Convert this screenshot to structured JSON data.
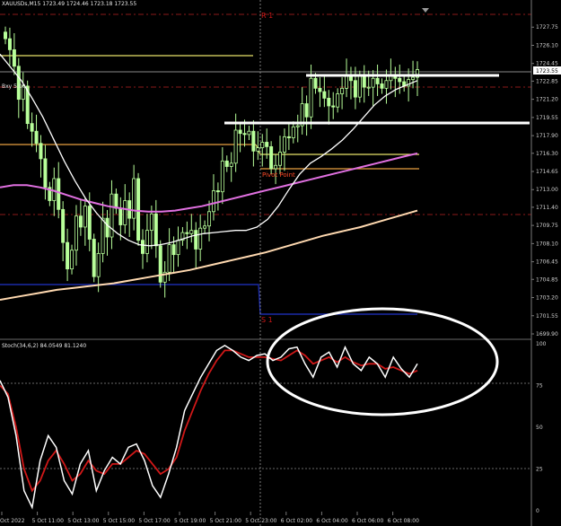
{
  "window": {
    "symbol_line": "XAUUSDs,M15",
    "ohlc_line": "1723.49 1724.46 1723.18 1723.55",
    "small_label": "Bxy 5.00"
  },
  "colors": {
    "background": "#000000",
    "candle": "#b8ff9a",
    "ma_fast": "#ffffff",
    "ma_mid": "#e070e0",
    "ma_slow": "#ffd9b0",
    "level_yellow": "#e8e26a",
    "level_orange": "#e8a040",
    "level_blue": "#1a2aa8",
    "level_red": "#8b1a1a",
    "stoch_main": "#ffffff",
    "stoch_signal": "#d01818",
    "annotation": "#ffffff"
  },
  "chart_data": [
    {
      "type": "candlestick",
      "instrument": "XAUUSDs",
      "timeframe": "M15",
      "price_axis_ticks": [
        "1727.75",
        "1726.10",
        "1724.45",
        "1722.85",
        "1721.20",
        "1719.55",
        "1717.90",
        "1716.30",
        "1714.65",
        "1713.00",
        "1711.40",
        "1709.75",
        "1708.10",
        "1706.45",
        "1704.85",
        "1703.20",
        "1701.55",
        "1699.90"
      ],
      "current_price": "1723.55",
      "ylim": [
        1699.9,
        1729.4
      ],
      "time_ticks": [
        "Oct 2022",
        "5 Oct 11:00",
        "5 Oct 13:00",
        "5 Oct 15:00",
        "5 Oct 17:00",
        "5 Oct 19:00",
        "5 Oct 21:00",
        "5 Oct 23:00",
        "6 Oct 02:00",
        "6 Oct 04:00",
        "6 Oct 06:00",
        "6 Oct 08:00"
      ],
      "close": [
        1726.7,
        1725.7,
        1724.2,
        1721.2,
        1722.4,
        1719.0,
        1718.3,
        1717.2,
        1715.8,
        1713.2,
        1712.0,
        1714.0,
        1711.2,
        1708.2,
        1705.8,
        1707.5,
        1710.6,
        1709.6,
        1711.5,
        1708.5,
        1705.1,
        1707.2,
        1710.4,
        1708.7,
        1712.6,
        1711.3,
        1709.8,
        1712.0,
        1710.4,
        1714.0,
        1708.4,
        1707.2,
        1709.3,
        1710.8,
        1707.9,
        1704.6,
        1705.5,
        1708.0,
        1707.1,
        1708.4,
        1709.1,
        1709.0,
        1709.3,
        1707.6,
        1709.5,
        1709.7,
        1711.0,
        1712.9,
        1712.8,
        1715.6,
        1715.1,
        1715.4,
        1718.4,
        1718.1,
        1718.0,
        1718.3,
        1716.5,
        1716.8,
        1717.3,
        1716.9,
        1714.9,
        1715.2,
        1716.4,
        1717.8,
        1717.7,
        1718.7,
        1718.8,
        1720.8,
        1719.6,
        1723.1,
        1722.2,
        1721.9,
        1721.3,
        1720.6,
        1720.5,
        1721.7,
        1722.2,
        1723.4,
        1722.9,
        1721.4,
        1723.3,
        1722.3,
        1722.3,
        1723.1,
        1722.6,
        1722.2,
        1722.9,
        1723.4,
        1723.1,
        1722.8,
        1722.4,
        1723.0,
        1723.2,
        1723.9
      ],
      "ma_fast": [
        1725.3,
        1724.1,
        1722.9,
        1721.3,
        1719.6,
        1717.6,
        1715.6,
        1713.8,
        1712.2,
        1710.9,
        1709.8,
        1709.0,
        1708.4,
        1708.0,
        1707.9,
        1708.0,
        1708.2,
        1708.5,
        1708.8,
        1709.0,
        1709.1,
        1709.2,
        1709.3,
        1709.3,
        1709.6,
        1710.3,
        1711.5,
        1713.0,
        1714.4,
        1715.4,
        1716.0,
        1716.7,
        1717.5,
        1718.5,
        1719.6,
        1720.7,
        1721.5,
        1722.1,
        1722.5,
        1722.9
      ],
      "ma_mid": [
        1713.2,
        1713.4,
        1713.4,
        1713.2,
        1712.9,
        1712.5,
        1712.1,
        1711.8,
        1711.5,
        1711.3,
        1711.1,
        1711.0,
        1711.0,
        1711.1,
        1711.3,
        1711.5,
        1711.8,
        1712.1,
        1712.4,
        1712.7,
        1713.0,
        1713.3,
        1713.6,
        1713.9,
        1714.2,
        1714.5,
        1714.8,
        1715.1,
        1715.4,
        1715.7,
        1716.0,
        1716.3
      ],
      "ma_slow": [
        1703.0,
        1703.3,
        1703.6,
        1703.9,
        1704.1,
        1704.3,
        1704.5,
        1704.8,
        1705.1,
        1705.4,
        1705.7,
        1706.1,
        1706.5,
        1706.9,
        1707.3,
        1707.8,
        1708.3,
        1708.8,
        1709.2,
        1709.6,
        1710.1,
        1710.6,
        1711.1
      ],
      "levels": [
        {
          "name": "S1",
          "price": 1701.6
        },
        {
          "name": "Pivot Point",
          "price": 1715.2
        }
      ]
    },
    {
      "type": "line",
      "indicator": "Stoch(34,6,2)",
      "header": "Stoch(34,6,2) 84.0549 81.1240",
      "y_ticks": [
        "100",
        "75",
        "50",
        "25",
        "0"
      ],
      "ylim": [
        0,
        100
      ],
      "main": [
        78,
        68,
        45,
        12,
        2,
        30,
        45,
        38,
        18,
        10,
        28,
        36,
        12,
        24,
        32,
        28,
        38,
        40,
        30,
        15,
        8,
        22,
        38,
        60,
        70,
        80,
        88,
        96,
        99,
        96,
        92,
        90,
        93,
        94,
        90,
        92,
        97,
        98,
        88,
        80,
        92,
        95,
        86,
        98,
        88,
        84,
        92,
        88,
        80,
        92,
        85,
        80,
        88
      ],
      "signal": [
        75,
        70,
        50,
        25,
        12,
        18,
        30,
        36,
        28,
        18,
        22,
        30,
        24,
        22,
        28,
        28,
        32,
        36,
        34,
        28,
        22,
        25,
        32,
        48,
        60,
        72,
        82,
        90,
        96,
        96,
        94,
        92,
        92,
        92,
        91,
        90,
        93,
        96,
        93,
        88,
        90,
        92,
        89,
        92,
        89,
        87,
        88,
        88,
        85,
        86,
        84,
        82,
        84
      ]
    }
  ]
}
